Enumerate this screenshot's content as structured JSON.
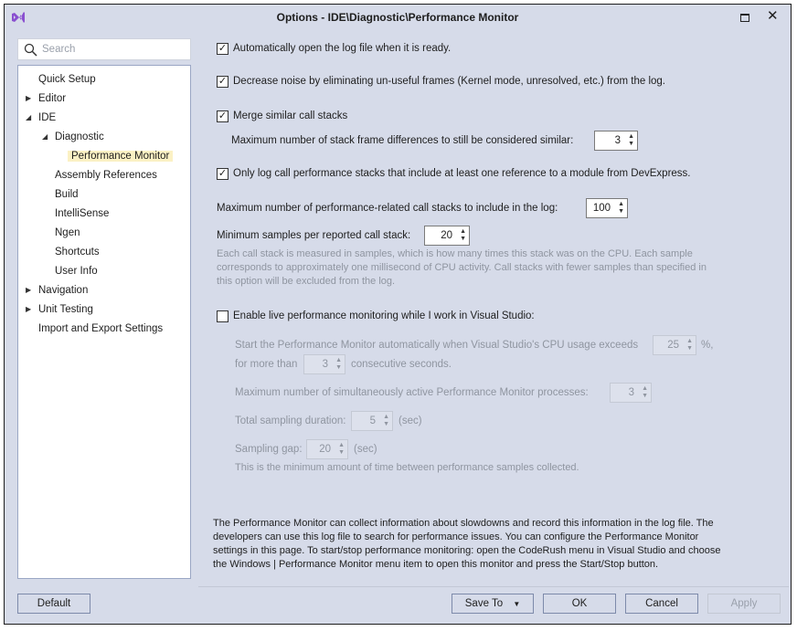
{
  "window": {
    "title": "Options - IDE\\Diagnostic\\Performance Monitor",
    "icon": "visual-studio-logo-icon"
  },
  "search": {
    "placeholder": "Search"
  },
  "tree": [
    {
      "label": "Quick Setup",
      "level": 0,
      "expander": ""
    },
    {
      "label": "Editor",
      "level": 0,
      "expander": "collapsed"
    },
    {
      "label": "IDE",
      "level": 0,
      "expander": "expanded"
    },
    {
      "label": "Diagnostic",
      "level": 1,
      "expander": "expanded"
    },
    {
      "label": "Performance Monitor",
      "level": 2,
      "selected": true
    },
    {
      "label": "Assembly References",
      "level": 1
    },
    {
      "label": "Build",
      "level": 1
    },
    {
      "label": "IntelliSense",
      "level": 1
    },
    {
      "label": "Ngen",
      "level": 1
    },
    {
      "label": "Shortcuts",
      "level": 1
    },
    {
      "label": "User Info",
      "level": 1
    },
    {
      "label": "Navigation",
      "level": 0,
      "expander": "collapsed"
    },
    {
      "label": "Unit Testing",
      "level": 0,
      "expander": "collapsed"
    },
    {
      "label": "Import and Export Settings",
      "level": 0
    }
  ],
  "options": {
    "auto_open": {
      "label": "Automatically open the log file when it is ready.",
      "checked": true
    },
    "decrease_noise": {
      "label": "Decrease noise by eliminating un-useful frames (Kernel mode, unresolved, etc.) from the log.",
      "checked": true
    },
    "merge": {
      "label": "Merge similar call stacks",
      "checked": true
    },
    "max_diff": {
      "label": "Maximum number of stack frame differences to still be considered similar:",
      "value": "3"
    },
    "only_log": {
      "label": "Only log call performance stacks that include at least one reference to a module from DevExpress.",
      "checked": true
    },
    "max_stacks": {
      "label": "Maximum number of performance-related call stacks to include in the log:",
      "value": "100"
    },
    "min_samples": {
      "label": "Minimum samples per reported call stack:",
      "value": "20"
    },
    "samples_desc1": "Each call stack is measured in samples, which is how many times this stack was on the CPU. Each sample",
    "samples_desc2": "corresponds to approximately one millisecond of CPU activity. Call stacks with fewer samples than specified in",
    "samples_desc3": "this option will be excluded from the log.",
    "live": {
      "label": "Enable live performance monitoring while I work in Visual Studio:",
      "checked": false
    },
    "cpu_label": "Start the Performance Monitor automatically when Visual Studio's CPU usage exceeds",
    "cpu_value": "25",
    "cpu_unit": "%,",
    "for_more": "for more than",
    "seconds_value": "3",
    "seconds_unit": "consecutive seconds.",
    "max_proc_label": "Maximum number of simultaneously active Performance Monitor processes:",
    "max_proc_value": "3",
    "duration_label": "Total sampling duration:",
    "duration_value": "5",
    "duration_unit": "(sec)",
    "gap_label": "Sampling gap:",
    "gap_value": "20",
    "gap_unit": "(sec)",
    "gap_desc": "This is the minimum amount of time between performance samples collected."
  },
  "info": [
    "The Performance Monitor can collect information about slowdowns and record this information in the log file. The",
    "developers can use this log file to search for performance issues. You can configure the Performance Monitor",
    "settings in this page. To start/stop performance monitoring: open the CodeRush menu in Visual Studio and choose",
    "the Windows | Performance Monitor menu item to open this monitor and press the Start/Stop button."
  ],
  "buttons": {
    "default": "Default",
    "save_to": "Save To",
    "ok": "OK",
    "cancel": "Cancel",
    "apply": "Apply"
  }
}
